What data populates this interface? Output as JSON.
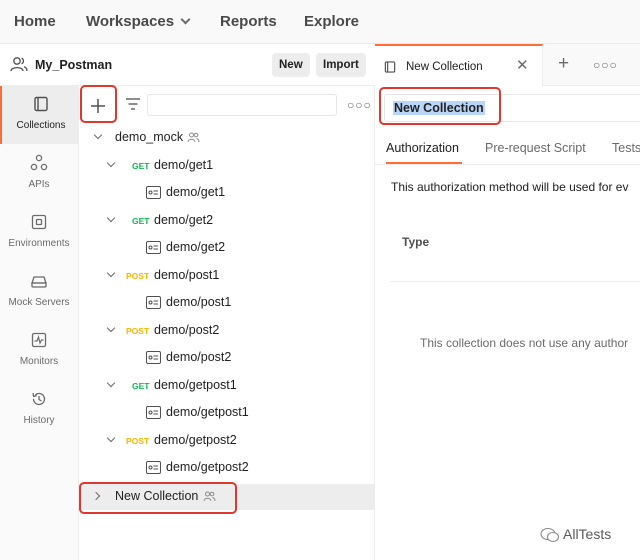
{
  "topnav": {
    "home": "Home",
    "workspaces": "Workspaces",
    "reports": "Reports",
    "explore": "Explore"
  },
  "workspace": {
    "name": "My_Postman",
    "new_label": "New",
    "import_label": "Import"
  },
  "rail": {
    "items": [
      {
        "label": "Collections",
        "icon": "collections-icon"
      },
      {
        "label": "APIs",
        "icon": "apis-icon"
      },
      {
        "label": "Environments",
        "icon": "environments-icon"
      },
      {
        "label": "Mock Servers",
        "icon": "mock-servers-icon"
      },
      {
        "label": "Monitors",
        "icon": "monitors-icon"
      },
      {
        "label": "History",
        "icon": "history-icon"
      }
    ]
  },
  "tree": {
    "collection": "demo_mock",
    "requests": [
      {
        "method": "GET",
        "name": "demo/get1",
        "example": "demo/get1"
      },
      {
        "method": "GET",
        "name": "demo/get2",
        "example": "demo/get2"
      },
      {
        "method": "POST",
        "name": "demo/post1",
        "example": "demo/post1"
      },
      {
        "method": "POST",
        "name": "demo/post2",
        "example": "demo/post2"
      },
      {
        "method": "GET",
        "name": "demo/getpost1",
        "example": "demo/getpost1"
      },
      {
        "method": "POST",
        "name": "demo/getpost2",
        "example": "demo/getpost2"
      }
    ],
    "new_collection": "New Collection"
  },
  "tab": {
    "label": "New Collection"
  },
  "editor": {
    "name_value": "New Collection",
    "subtabs": [
      "Authorization",
      "Pre-request Script",
      "Tests"
    ],
    "auth_desc": "This authorization method will be used for ev",
    "type_label": "Type",
    "no_auth": "This collection does not use any author"
  },
  "watermark": "AllTests",
  "colors": {
    "accent": "#ff6c37",
    "get": "#0cbb52",
    "post": "#ffb400",
    "highlight": "#e0382f"
  }
}
